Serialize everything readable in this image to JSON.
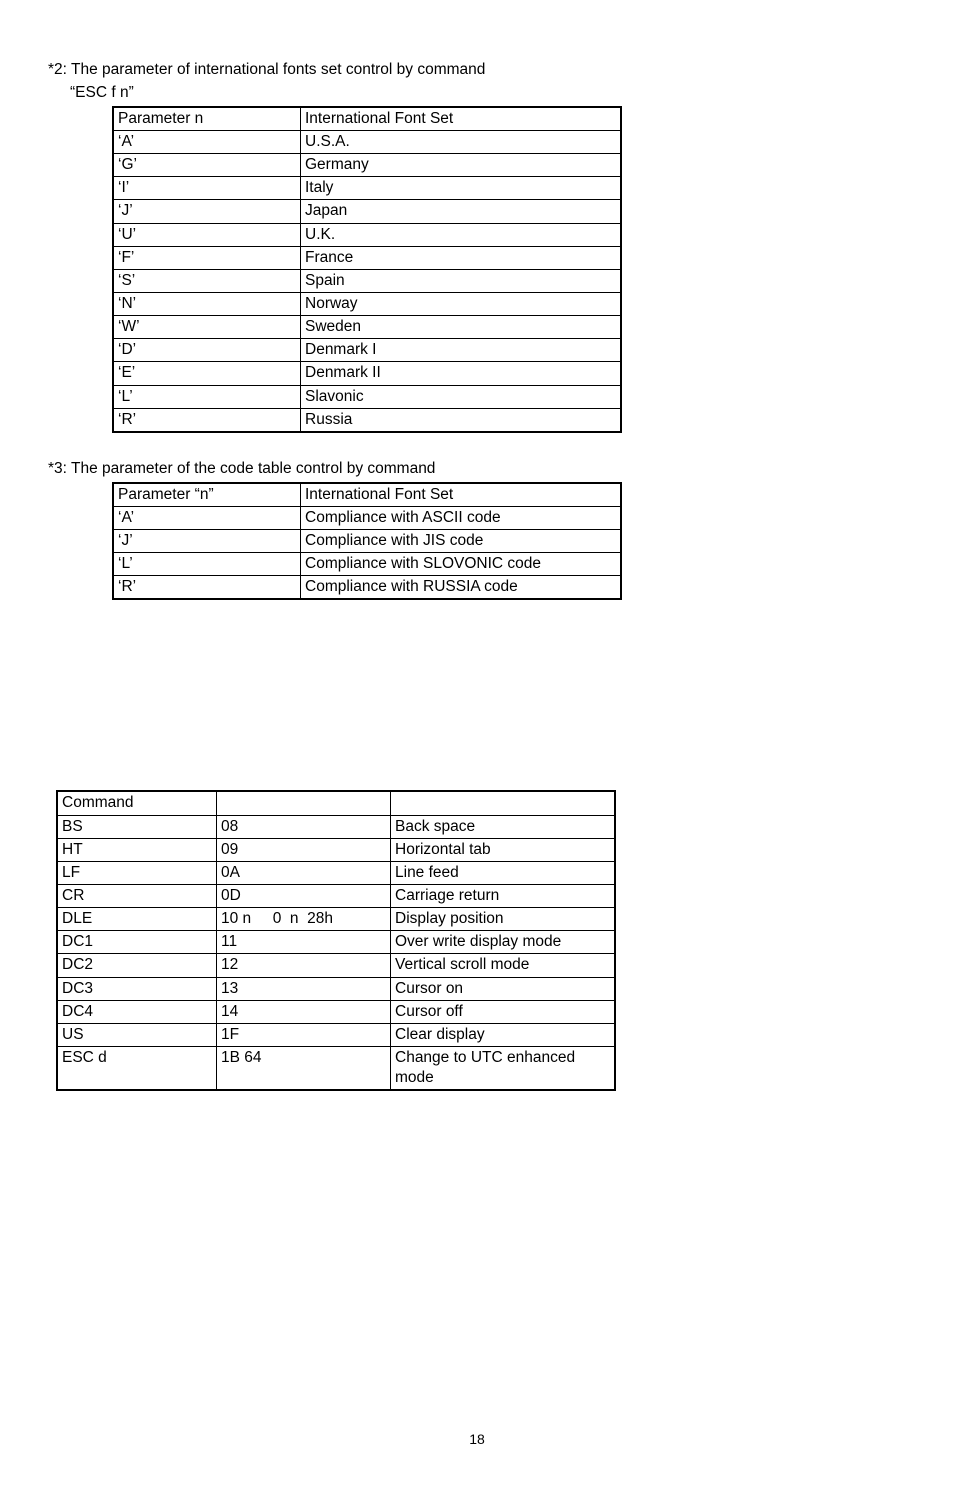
{
  "section1": {
    "heading": "*2: The parameter of international fonts set control by command",
    "subheading": "“ESC f n”",
    "table": {
      "columns": [
        "Parameter   n",
        "International Font Set"
      ],
      "rows": [
        [
          "‘A’",
          "U.S.A."
        ],
        [
          "‘G’",
          "Germany"
        ],
        [
          "‘I’",
          "Italy"
        ],
        [
          "‘J’",
          "Japan"
        ],
        [
          "‘U’",
          "U.K."
        ],
        [
          "‘F’",
          "France"
        ],
        [
          "‘S’",
          "Spain"
        ],
        [
          "‘N’",
          "Norway"
        ],
        [
          "‘W’",
          "Sweden"
        ],
        [
          "‘D’",
          "Denmark I"
        ],
        [
          "‘E’",
          "Denmark II"
        ],
        [
          "‘L’",
          "Slavonic"
        ],
        [
          "‘R’",
          "Russia"
        ]
      ]
    }
  },
  "section2": {
    "heading": "*3: The parameter of the code table control by command",
    "table": {
      "columns": [
        "Parameter   “n”",
        "International Font Set"
      ],
      "rows": [
        [
          "‘A’",
          "Compliance with ASCII code"
        ],
        [
          "‘J’",
          "Compliance with JIS code"
        ],
        [
          "‘L’",
          "Compliance with SLOVONIC code"
        ],
        [
          "‘R’",
          "Compliance with RUSSIA code"
        ]
      ]
    }
  },
  "section3": {
    "table": {
      "columns": [
        "Command",
        "",
        ""
      ],
      "rows": [
        [
          "BS",
          "08",
          "Back space"
        ],
        [
          "HT",
          "09",
          "Horizontal tab"
        ],
        [
          "LF",
          "0A",
          "Line feed"
        ],
        [
          "CR",
          "0D",
          "Carriage return"
        ],
        [
          "DLE",
          "10 n     0  n  28h",
          "Display position"
        ],
        [
          "DC1",
          "11",
          "Over write display mode"
        ],
        [
          "DC2",
          "12",
          "Vertical scroll mode"
        ],
        [
          "DC3",
          "13",
          "Cursor on"
        ],
        [
          "DC4",
          "14",
          "Cursor off"
        ],
        [
          "US",
          "1F",
          "Clear display"
        ],
        [
          "ESC d",
          "1B 64",
          "Change to UTC enhanced mode"
        ]
      ]
    }
  },
  "page_number": "18"
}
